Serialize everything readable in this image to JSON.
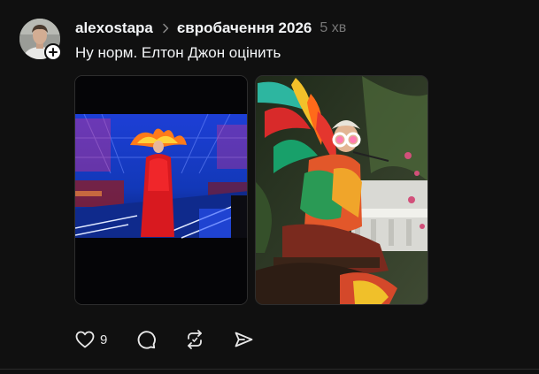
{
  "post": {
    "username": "alexostapa",
    "community": "євробачення 2026",
    "time": "5 хв",
    "text": "Ну норм. Елтон Джон оцінить",
    "like_count": "9"
  },
  "icons": {
    "follow": "plus-icon",
    "separator": "chevron-right-icon",
    "like": "heart-icon",
    "comment": "comment-icon",
    "repost": "repost-icon",
    "share": "send-icon"
  },
  "colors": {
    "background": "#101010",
    "text_primary": "#f3f5f7",
    "text_secondary": "#777777"
  }
}
